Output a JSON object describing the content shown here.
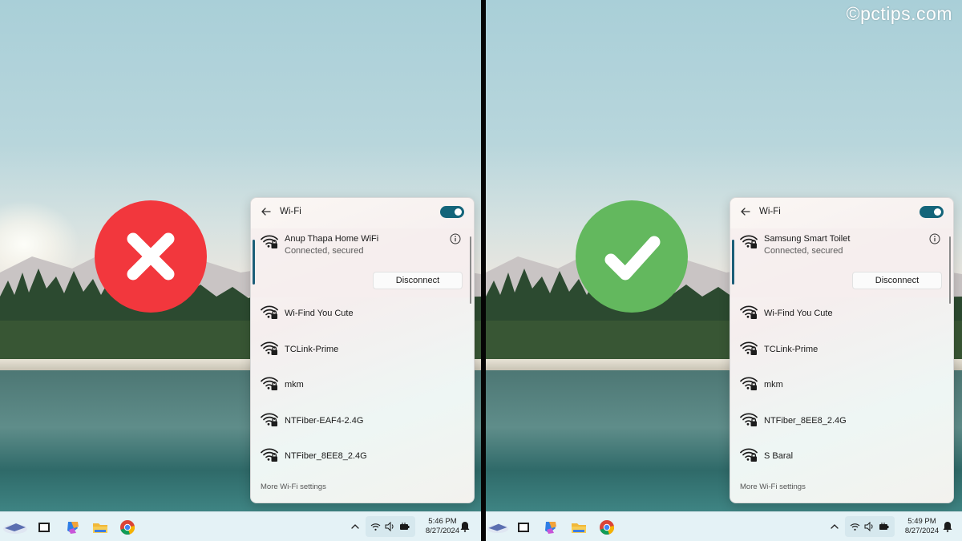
{
  "watermark": "©pctips.com",
  "left": {
    "badge": "x-icon",
    "badge_color": "#f2373d",
    "wifi": {
      "title": "Wi-Fi",
      "toggle_on": true,
      "connected": {
        "name": "Anup Thapa Home WiFi",
        "status": "Connected, secured",
        "disconnect_label": "Disconnect"
      },
      "networks": [
        {
          "name": "Wi-Find You Cute"
        },
        {
          "name": "TCLink-Prime"
        },
        {
          "name": "mkm"
        },
        {
          "name": "NTFiber-EAF4-2.4G"
        },
        {
          "name": "NTFiber_8EE8_2.4G"
        }
      ],
      "more_settings": "More Wi-Fi settings"
    },
    "taskbar": {
      "time": "5:46 PM",
      "date": "8/27/2024"
    }
  },
  "right": {
    "badge": "check-icon",
    "badge_color": "#63b85e",
    "wifi": {
      "title": "Wi-Fi",
      "toggle_on": true,
      "connected": {
        "name": "Samsung Smart Toilet",
        "status": "Connected, secured",
        "disconnect_label": "Disconnect"
      },
      "networks": [
        {
          "name": "Wi-Find You Cute"
        },
        {
          "name": "TCLink-Prime"
        },
        {
          "name": "mkm"
        },
        {
          "name": "NTFiber_8EE8_2.4G"
        },
        {
          "name": "S Baral"
        }
      ],
      "more_settings": "More Wi-Fi settings"
    },
    "taskbar": {
      "time": "5:49 PM",
      "date": "8/27/2024"
    }
  },
  "colors": {
    "toggle": "#14657a",
    "accent_bar": "#1b5e78",
    "taskbar": "#e4f2f6"
  }
}
